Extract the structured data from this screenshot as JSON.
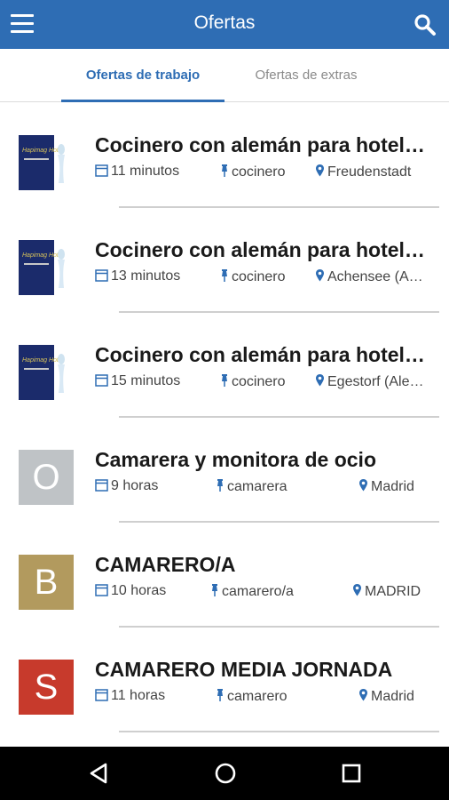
{
  "appbar": {
    "title": "Ofertas",
    "menu_icon": "menu-icon",
    "search_icon": "search-icon",
    "color": "#2e6db4"
  },
  "tabs": [
    {
      "label": "Ofertas de trabajo",
      "active": true
    },
    {
      "label": "Ofertas de extras",
      "active": false
    }
  ],
  "jobs": [
    {
      "title": "Cocinero con alemán para hoteles",
      "time": "11 minutos",
      "category": "cocinero",
      "location": "Freudenstadt",
      "thumb": "logo"
    },
    {
      "title": "Cocinero con alemán para hoteles",
      "time": "13 minutos",
      "category": "cocinero",
      "location": "Achensee (Austria)",
      "thumb": "logo"
    },
    {
      "title": "Cocinero con alemán para hoteles",
      "time": "15 minutos",
      "category": "cocinero",
      "location": "Egestorf (Alemania)",
      "thumb": "logo"
    },
    {
      "title": "Camarera y monitora de ocio",
      "time": "9 horas",
      "category": "camarera",
      "location": "Madrid",
      "thumb": "letter",
      "letter": "O",
      "color": "#bfc3c6"
    },
    {
      "title": "CAMARERO/A",
      "time": "10 horas",
      "category": "camarero/a",
      "location": "MADRID",
      "thumb": "letter",
      "letter": "B",
      "color": "#b29a5e"
    },
    {
      "title": "CAMARERO MEDIA JORNADA",
      "time": "11 horas",
      "category": "camarero",
      "location": "Madrid",
      "thumb": "letter",
      "letter": "S",
      "color": "#c73a2c"
    }
  ],
  "logo_text": "Hapimag Hotel",
  "navbar": {
    "back_icon": "back-triangle-icon",
    "home_icon": "home-circle-icon",
    "recents_icon": "recents-square-icon"
  }
}
